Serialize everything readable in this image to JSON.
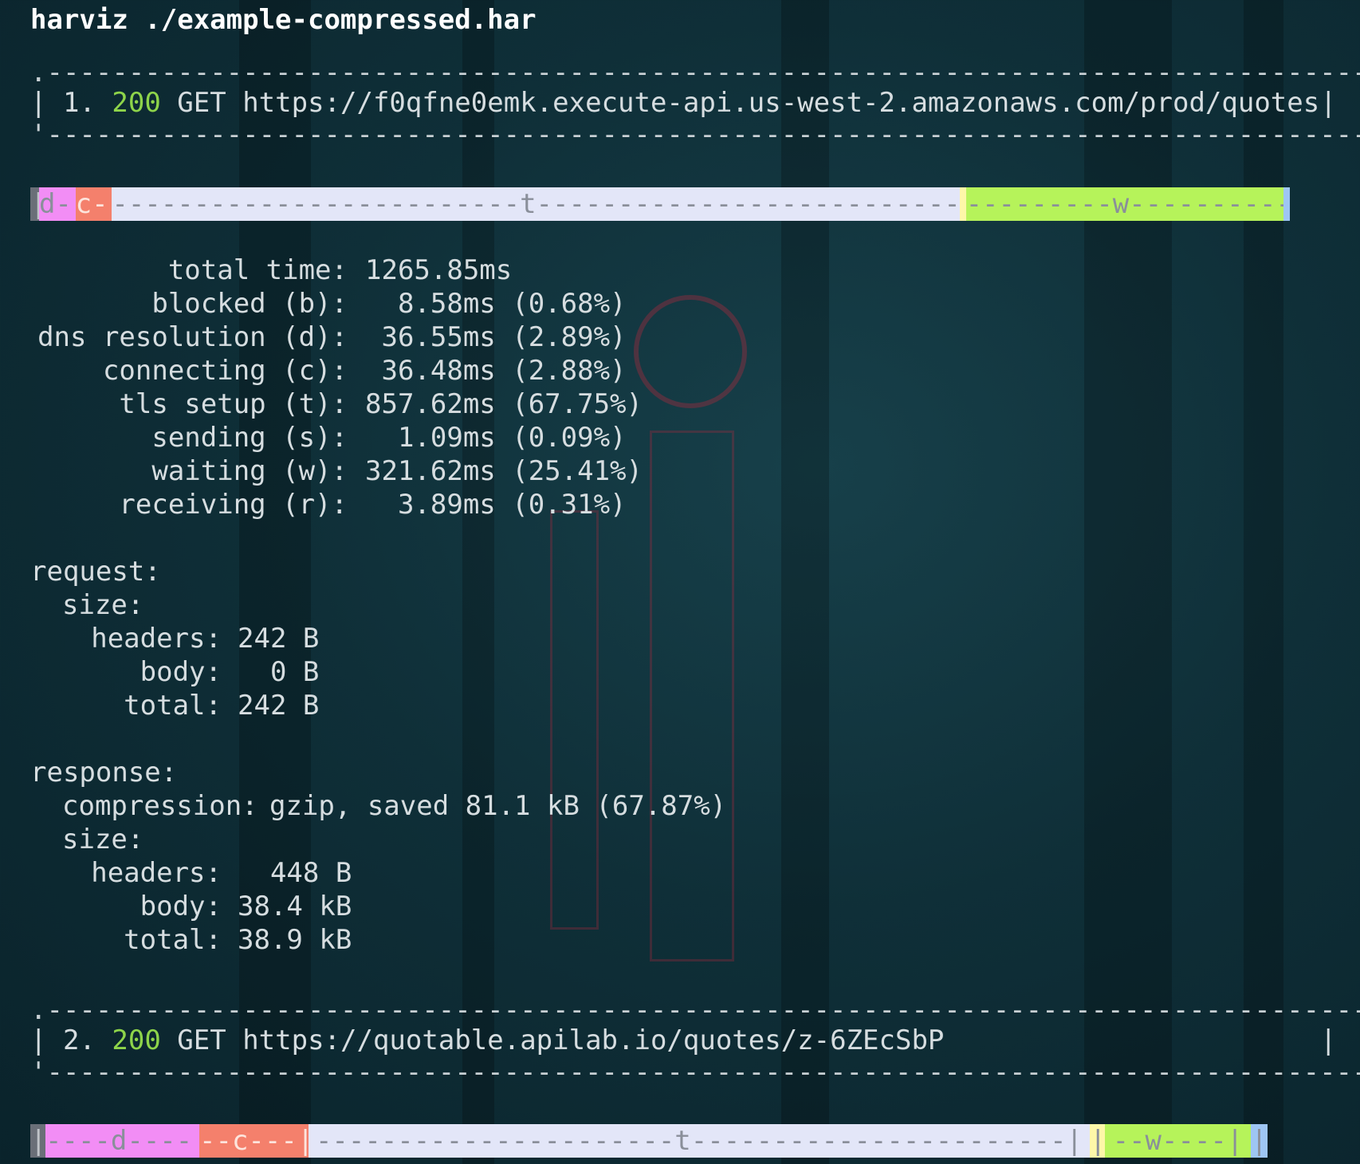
{
  "command": "harviz ./example-compressed.har",
  "colors": {
    "background": "#0f2f38",
    "status_ok": "#8ed44a",
    "blocked": "#6a6f78",
    "dns": "#f28df5",
    "connect": "#f4806c",
    "tls": "#e3e6f8",
    "send": "#fdf7a8",
    "wait": "#b6f35a",
    "receive": "#9ec6f4"
  },
  "entries": [
    {
      "index": "1.",
      "status": "200",
      "method": "GET",
      "url": "https://f0qfne0emk.execute-api.us-west-2.amazonaws.com/prod/quotes",
      "timeline": {
        "blocked": {
          "label": "|",
          "fraction": 0.0068
        },
        "dns": {
          "label": "d-|",
          "fraction": 0.0289
        },
        "connect": {
          "label": "c-|",
          "fraction": 0.0288
        },
        "tls": {
          "label": "-------------------------t--------------------------|",
          "fraction": 0.6775
        },
        "send": {
          "label": "|",
          "fraction": 0.0009
        },
        "wait": {
          "label": "---------w----------|",
          "fraction": 0.2541
        },
        "receive": {
          "label": "|",
          "fraction": 0.0031
        }
      },
      "timings": [
        {
          "label": "total time:",
          "value": "1265.85ms"
        },
        {
          "label": "blocked (b):",
          "value": "  8.58ms (0.68%)"
        },
        {
          "label": "dns resolution (d):",
          "value": " 36.55ms (2.89%)"
        },
        {
          "label": "connecting (c):",
          "value": " 36.48ms (2.88%)"
        },
        {
          "label": "tls setup (t):",
          "value": "857.62ms (67.75%)"
        },
        {
          "label": "sending (s):",
          "value": "  1.09ms (0.09%)"
        },
        {
          "label": "waiting (w):",
          "value": "321.62ms (25.41%)"
        },
        {
          "label": "receiving (r):",
          "value": "  3.89ms (0.31%)"
        }
      ],
      "request": {
        "heading": "request:",
        "size_label": "size:",
        "headers_label": "headers:",
        "headers": "242 B",
        "body_label": "body:",
        "body": "  0 B",
        "total_label": "total:",
        "total": "242 B"
      },
      "response": {
        "heading": "response:",
        "compression_label": "compression:",
        "compression": "gzip, saved 81.1 kB (67.87%)",
        "size_label": "size:",
        "headers_label": "headers:",
        "headers": "  448 B",
        "body_label": "body:",
        "body": "38.4 kB",
        "total_label": "total:",
        "total": "38.9 kB"
      }
    },
    {
      "index": "2.",
      "status": "200",
      "method": "GET",
      "url": "https://quotable.apilab.io/quotes/z-6ZEcSbP",
      "timeline": {
        "blocked": {
          "label": "|",
          "fraction": 0.012
        },
        "dns": {
          "label": "----d----|",
          "fraction": 0.122
        },
        "connect": {
          "label": "--c---|",
          "fraction": 0.087
        },
        "tls": {
          "label": "----------------------t-----------------------|",
          "fraction": 0.62
        },
        "send": {
          "label": "|",
          "fraction": 0.012
        },
        "wait": {
          "label": "--w----|",
          "fraction": 0.116
        },
        "receive": {
          "label": "|",
          "fraction": 0.013
        }
      }
    }
  ]
}
